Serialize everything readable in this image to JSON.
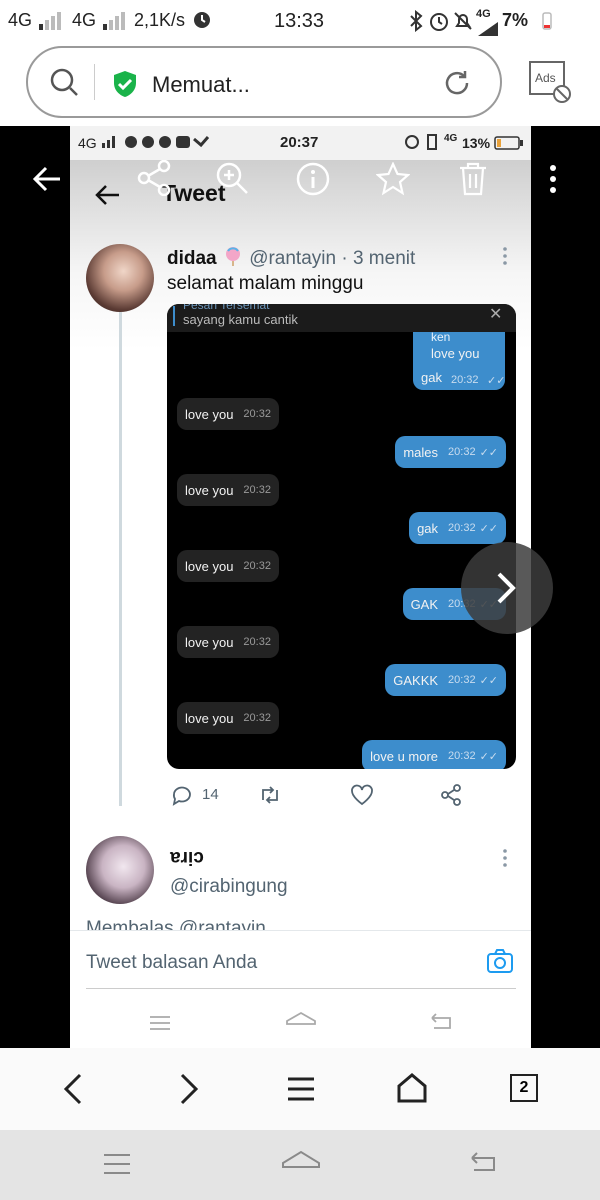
{
  "status_bar": {
    "signal1": "4G",
    "signal2": "4G",
    "speed": "2,1K/s",
    "time": "13:33",
    "network": "4G",
    "battery": "7%"
  },
  "browser": {
    "url_text": "Memuat...",
    "ads_label": "Ads",
    "tab_count": "2"
  },
  "inner_status_bar": {
    "signal": "4G",
    "time": "20:37",
    "network": "4G",
    "battery": "13%"
  },
  "twitter": {
    "header_title": "Tweet",
    "tweet": {
      "name": "didaa",
      "handle": "@rantayin",
      "time": "· 3 menit",
      "text": "selamat malam minggu",
      "replies": "14"
    },
    "chat": {
      "reply_header": "Pesan Tersemat",
      "reply_preview": "sayang kamu cantik",
      "top_bubble_line1": "ken",
      "top_bubble_line2": "love you",
      "top_bubble_line3": "gak",
      "messages": [
        {
          "text": "love you",
          "time": "20:32",
          "dir": "in"
        },
        {
          "text": "males",
          "time": "20:32",
          "dir": "out"
        },
        {
          "text": "love you",
          "time": "20:32",
          "dir": "in"
        },
        {
          "text": "gak",
          "time": "20:32",
          "dir": "out"
        },
        {
          "text": "love you",
          "time": "20:32",
          "dir": "in"
        },
        {
          "text": "GAK",
          "time": "20:32",
          "dir": "out"
        },
        {
          "text": "love you",
          "time": "20:32",
          "dir": "in"
        },
        {
          "text": "GAKKK",
          "time": "20:32",
          "dir": "out"
        },
        {
          "text": "love you",
          "time": "20:32",
          "dir": "in"
        },
        {
          "text": "love u more",
          "time": "20:32",
          "dir": "out"
        }
      ],
      "top_time": "20:32"
    },
    "reply_tweet": {
      "name": "cira",
      "handle": "@cirabingung",
      "replying": "Membalas @rantayin"
    },
    "reply_box_placeholder": "Tweet balasan Anda"
  },
  "colors": {
    "twitter_blue": "#1d9bf0",
    "bubble_out": "#3d8dcc",
    "bubble_in": "#232323",
    "shield_green": "#1ab34a"
  }
}
